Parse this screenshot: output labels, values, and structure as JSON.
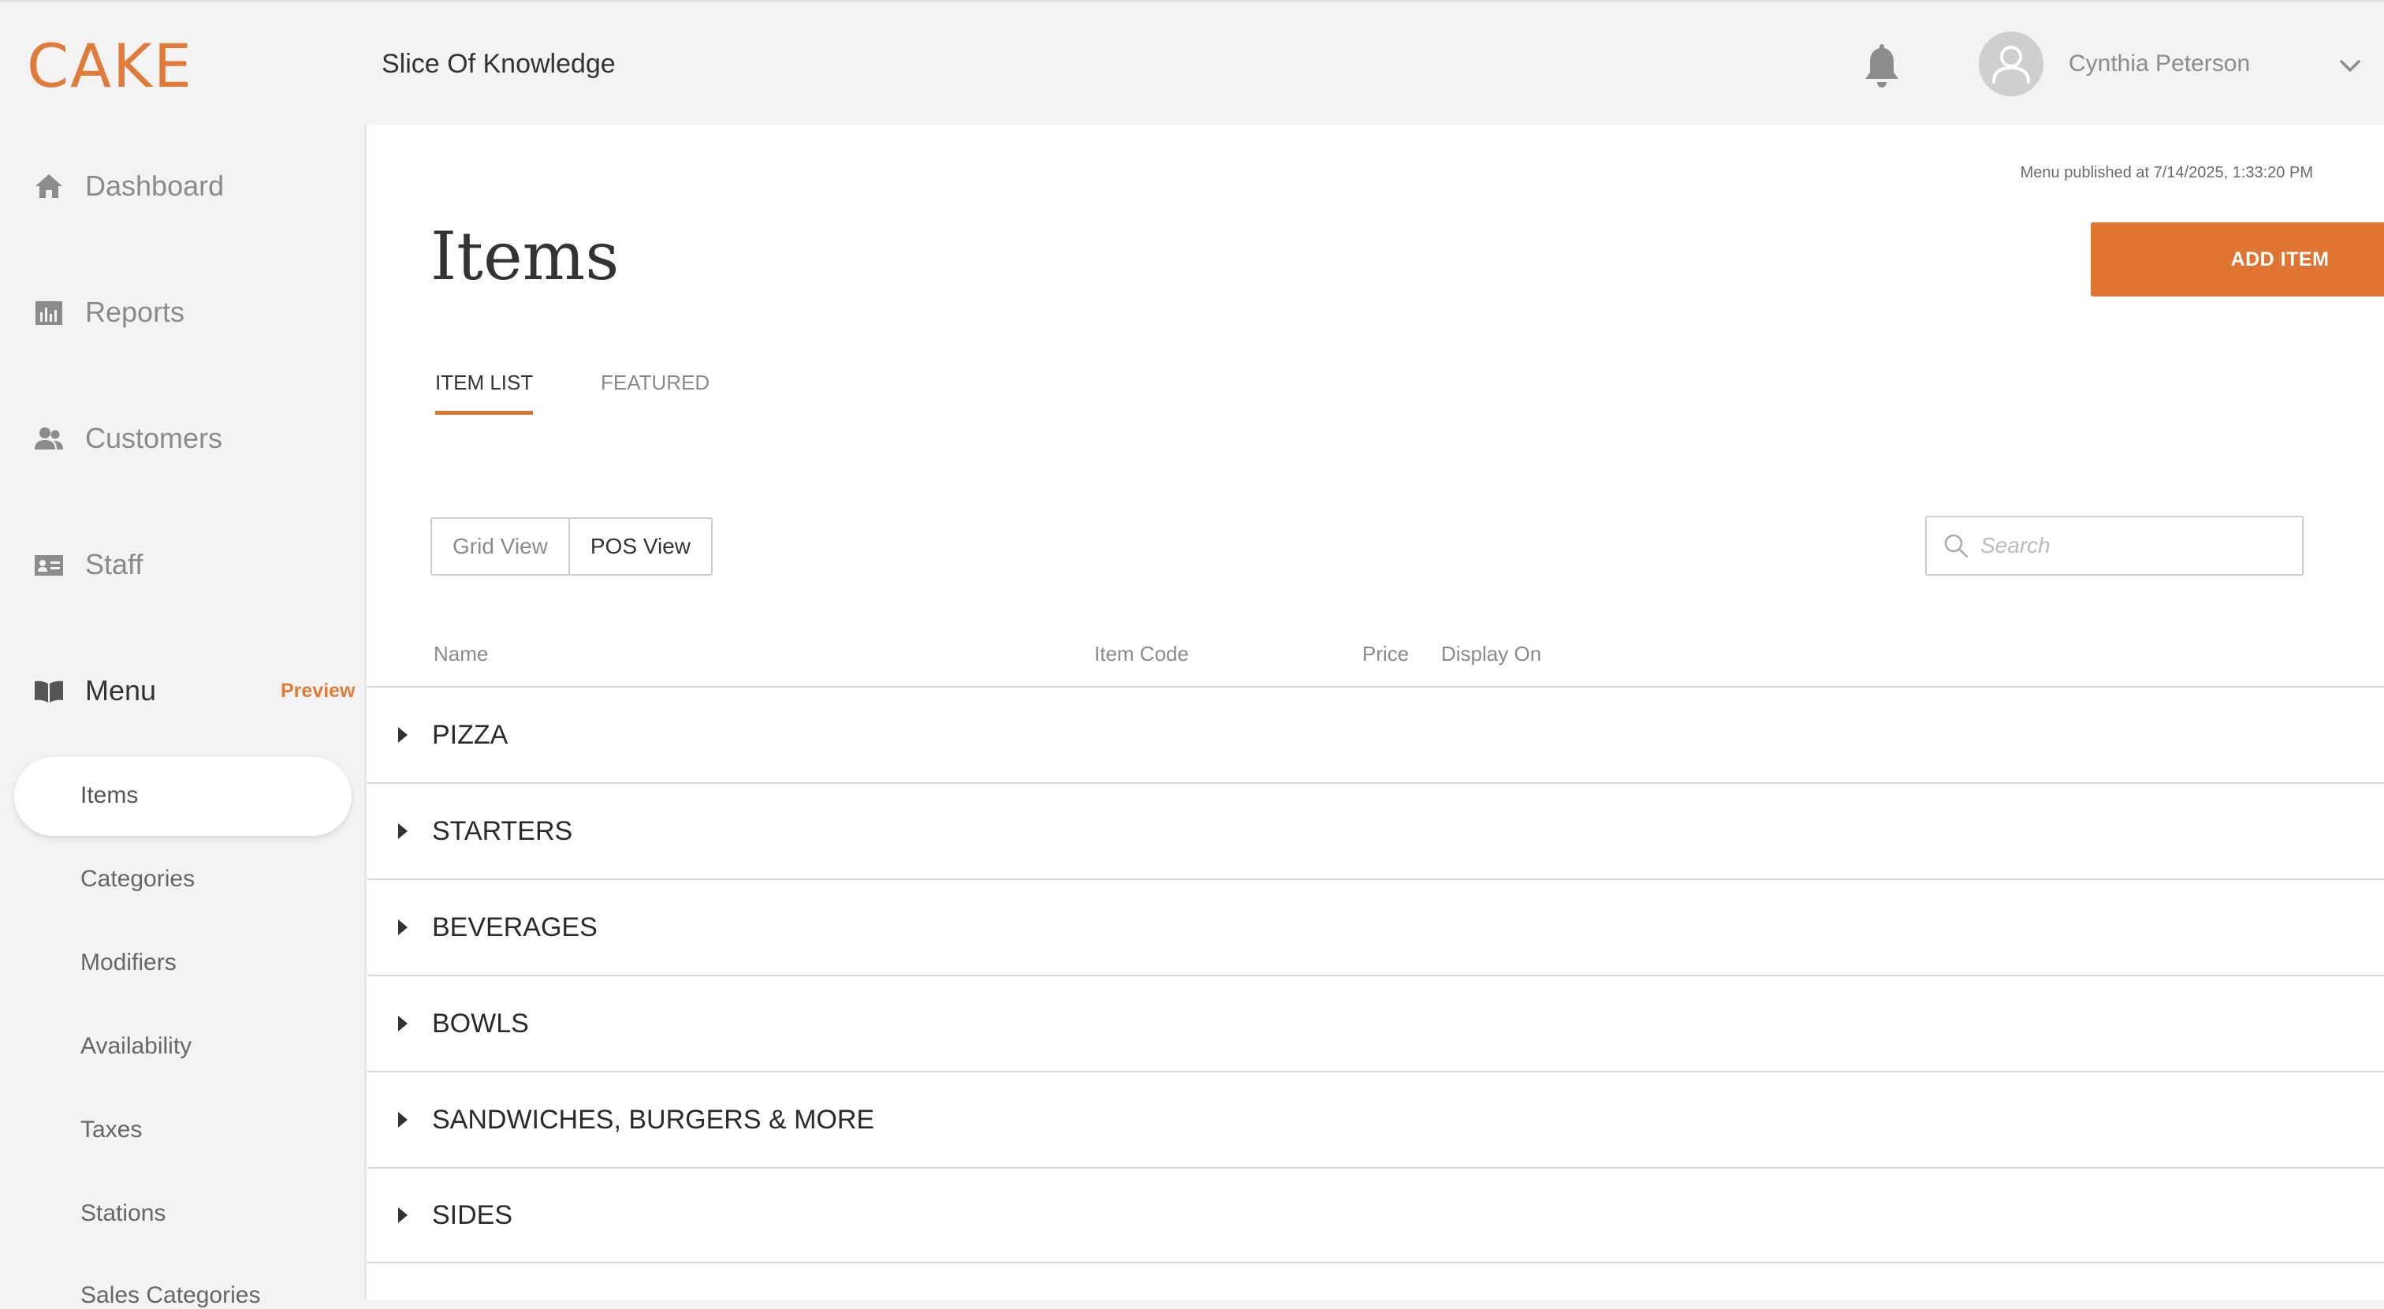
{
  "header": {
    "logo_text": "CAKE",
    "restaurant_name": "Slice Of Knowledge",
    "user_name": "Cynthia Peterson",
    "icons": [
      "bell-icon",
      "user-avatar-icon",
      "chevron-down-icon"
    ]
  },
  "sidebar": {
    "items": [
      {
        "label": "Dashboard",
        "icon": "home-icon"
      },
      {
        "label": "Reports",
        "icon": "bar-chart-icon"
      },
      {
        "label": "Customers",
        "icon": "people-icon"
      },
      {
        "label": "Staff",
        "icon": "id-card-icon"
      },
      {
        "label": "Menu",
        "icon": "book-icon"
      }
    ],
    "preview_label": "Preview",
    "menu_subitems": [
      "Items",
      "Categories",
      "Modifiers",
      "Availability",
      "Taxes",
      "Stations",
      "Sales Categories"
    ],
    "active_subitem": "Items"
  },
  "main": {
    "published_text": "Menu published at 7/14/2025, 1:33:20 PM",
    "title": "Items",
    "add_button_label": "ADD ITEM",
    "tabs": [
      {
        "label": "ITEM LIST",
        "active": true
      },
      {
        "label": "FEATURED",
        "active": false
      }
    ],
    "view_toggle": {
      "grid_label": "Grid View",
      "pos_label": "POS View",
      "selected": "POS View"
    },
    "search": {
      "placeholder": "Search",
      "value": ""
    },
    "columns": [
      "Name",
      "Item Code",
      "Price",
      "Display On"
    ],
    "categories": [
      "PIZZA",
      "STARTERS",
      "BEVERAGES",
      "BOWLS",
      "SANDWICHES, BURGERS & MORE",
      "SIDES"
    ]
  },
  "colors": {
    "accent": "#e07431",
    "logo": "#e07b39",
    "sidebar_bg": "#f3f3f3",
    "main_bg": "#ffffff"
  }
}
